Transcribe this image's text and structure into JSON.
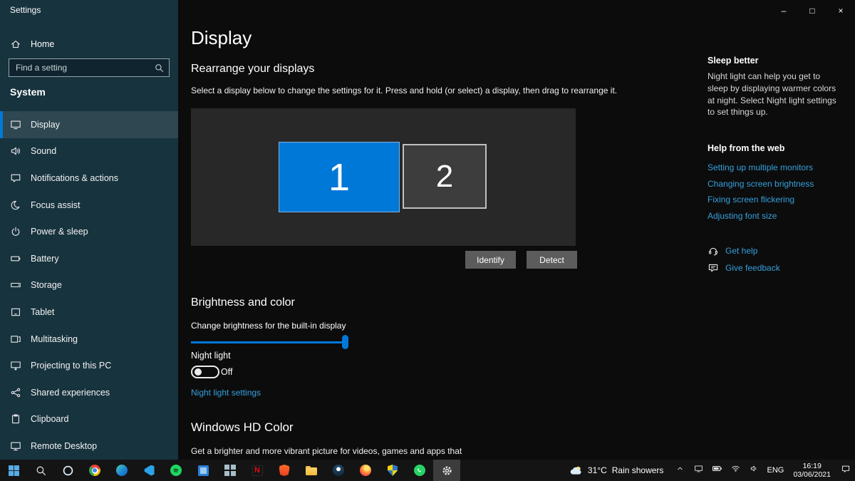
{
  "window": {
    "app_title": "Settings",
    "minimize": "–",
    "maximize": "□",
    "close": "×"
  },
  "sidebar": {
    "home_label": "Home",
    "search_placeholder": "Find a setting",
    "section_label": "System",
    "items": [
      {
        "label": "Display",
        "icon": "display-icon",
        "selected": true
      },
      {
        "label": "Sound",
        "icon": "sound-icon"
      },
      {
        "label": "Notifications & actions",
        "icon": "notifications-icon"
      },
      {
        "label": "Focus assist",
        "icon": "focus-assist-icon"
      },
      {
        "label": "Power & sleep",
        "icon": "power-icon"
      },
      {
        "label": "Battery",
        "icon": "battery-icon"
      },
      {
        "label": "Storage",
        "icon": "storage-icon"
      },
      {
        "label": "Tablet",
        "icon": "tablet-icon"
      },
      {
        "label": "Multitasking",
        "icon": "multitasking-icon"
      },
      {
        "label": "Projecting to this PC",
        "icon": "projecting-icon"
      },
      {
        "label": "Shared experiences",
        "icon": "shared-experiences-icon"
      },
      {
        "label": "Clipboard",
        "icon": "clipboard-icon"
      },
      {
        "label": "Remote Desktop",
        "icon": "remote-desktop-icon"
      }
    ]
  },
  "main": {
    "page_title": "Display",
    "rearrange": {
      "heading": "Rearrange your displays",
      "description": "Select a display below to change the settings for it. Press and hold (or select) a display, then drag to rearrange it.",
      "display1": "1",
      "display2": "2",
      "identify_label": "Identify",
      "detect_label": "Detect"
    },
    "brightness": {
      "heading": "Brightness and color",
      "slider_label": "Change brightness for the built-in display",
      "slider_percent": 98,
      "night_light_label": "Night light",
      "night_light_state": "Off",
      "night_light_link": "Night light settings"
    },
    "hd_color": {
      "heading": "Windows HD Color",
      "description": "Get a brighter and more vibrant picture for videos, games and apps that"
    }
  },
  "right_panel": {
    "sleep_better_heading": "Sleep better",
    "sleep_better_text": "Night light can help you get to sleep by displaying warmer colors at night. Select Night light settings to set things up.",
    "help_heading": "Help from the web",
    "help_links": [
      "Setting up multiple monitors",
      "Changing screen brightness",
      "Fixing screen flickering",
      "Adjusting font size"
    ],
    "get_help_label": "Get help",
    "give_feedback_label": "Give feedback"
  },
  "taskbar": {
    "apps": [
      {
        "name": "start"
      },
      {
        "name": "search"
      },
      {
        "name": "cortana"
      },
      {
        "name": "chrome"
      },
      {
        "name": "edge"
      },
      {
        "name": "vscode"
      },
      {
        "name": "spotify"
      },
      {
        "name": "photos"
      },
      {
        "name": "tiles"
      },
      {
        "name": "netflix"
      },
      {
        "name": "brave"
      },
      {
        "name": "file-explorer"
      },
      {
        "name": "steam"
      },
      {
        "name": "firefox"
      },
      {
        "name": "security"
      },
      {
        "name": "whatsapp"
      },
      {
        "name": "settings",
        "active": true
      }
    ],
    "weather_temp": "31°C",
    "weather_condition": "Rain showers",
    "language": "ENG",
    "time": "16:19",
    "date": "03/06/2021"
  },
  "colors": {
    "accent": "#0078d7",
    "link": "#35a0dc",
    "sidebar_bg": "#17333e",
    "content_bg": "#0c0c0c",
    "taskbar_bg": "#141414"
  }
}
